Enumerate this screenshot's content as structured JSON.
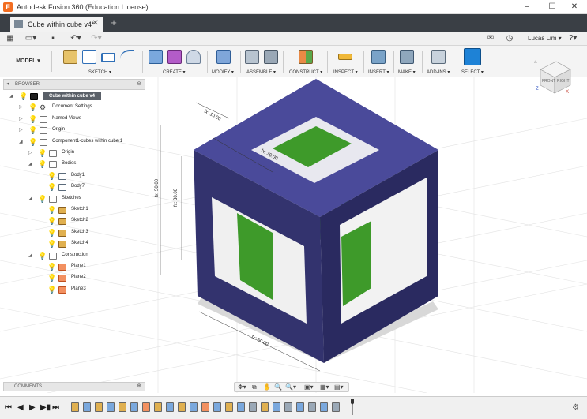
{
  "window": {
    "title": "Autodesk Fusion 360 (Education License)",
    "logo": "F",
    "minimize": "–",
    "maximize": "☐",
    "close": "✕"
  },
  "tabs": [
    {
      "label": "Cube within cube v4*",
      "close": "✕"
    }
  ],
  "tab_new": "+",
  "qat": {
    "user": "Lucas Lim ▾",
    "help": "?▾",
    "grid": "▦",
    "file": "▭▾",
    "save": "▪",
    "undo": "↶▾",
    "redo": "↷▾"
  },
  "ribbon": {
    "workspace": "MODEL ▾",
    "groups": [
      {
        "label": "SKETCH ▾"
      },
      {
        "label": "CREATE ▾"
      },
      {
        "label": "MODIFY ▾"
      },
      {
        "label": "ASSEMBLE ▾"
      },
      {
        "label": "CONSTRUCT ▾"
      },
      {
        "label": "INSPECT ▾"
      },
      {
        "label": "INSERT ▾"
      },
      {
        "label": "MAKE ▾"
      },
      {
        "label": "ADD-INS ▾"
      },
      {
        "label": "SELECT ▾"
      }
    ]
  },
  "browser": {
    "title": "BROWSER",
    "collapse": "◂",
    "options": "⊖",
    "items": [
      {
        "label": "Cube within cube v4",
        "kind": "root",
        "twisty": "◢"
      },
      {
        "label": "Document Settings",
        "kind": "cog",
        "twisty": "▷"
      },
      {
        "label": "Named Views",
        "kind": "folder",
        "twisty": "▷"
      },
      {
        "label": "Origin",
        "kind": "folder",
        "twisty": "▷"
      },
      {
        "label": "Component1-cubes within cube:1",
        "kind": "folder",
        "twisty": "◢"
      },
      {
        "label": "Origin",
        "kind": "folder",
        "twisty": "▷"
      },
      {
        "label": "Bodies",
        "kind": "folder",
        "twisty": "◢"
      },
      {
        "label": "Body1",
        "kind": "body",
        "twisty": ""
      },
      {
        "label": "Body7",
        "kind": "body",
        "twisty": ""
      },
      {
        "label": "Sketches",
        "kind": "folder",
        "twisty": "◢"
      },
      {
        "label": "Sketch1",
        "kind": "sketch",
        "twisty": ""
      },
      {
        "label": "Sketch2",
        "kind": "sketch",
        "twisty": ""
      },
      {
        "label": "Sketch3",
        "kind": "sketch",
        "twisty": ""
      },
      {
        "label": "Sketch4",
        "kind": "sketch",
        "twisty": ""
      },
      {
        "label": "Construction",
        "kind": "folder",
        "twisty": "◢"
      },
      {
        "label": "Plane1",
        "kind": "plane",
        "twisty": ""
      },
      {
        "label": "Plane2",
        "kind": "plane",
        "twisty": ""
      },
      {
        "label": "Plane3",
        "kind": "plane",
        "twisty": ""
      }
    ]
  },
  "dimensions": {
    "d1": "fx: 10.00",
    "d2": "fx: 50.00",
    "d3": "fx: 30.00",
    "d4": "fx: 30.00",
    "d5": "fx: 50.00"
  },
  "viewcube": {
    "face_front": "FRONT",
    "face_right": "RIGHT",
    "axis_x": "X",
    "axis_y": "Y",
    "axis_z": "Z",
    "home": "⌂"
  },
  "comments": {
    "title": "COMMENTS",
    "options": "⊕"
  },
  "nav": {
    "orbit": "✥▾",
    "look": "⧉",
    "pan": "✋",
    "zoom": "🔍",
    "fit": "🔍▾",
    "display": "▣▾",
    "grid": "▦▾",
    "viewports": "▤▾"
  },
  "timeline": {
    "first": "⏮",
    "prev": "◀",
    "play": "▶",
    "next": "▶▮",
    "last": "⏭",
    "settings": "⚙"
  },
  "colors": {
    "outer_cube": "#38387a",
    "inner_cube": "#3e9a2a",
    "tabbar": "#3a3f45",
    "select_blue": "#1e82d6"
  }
}
